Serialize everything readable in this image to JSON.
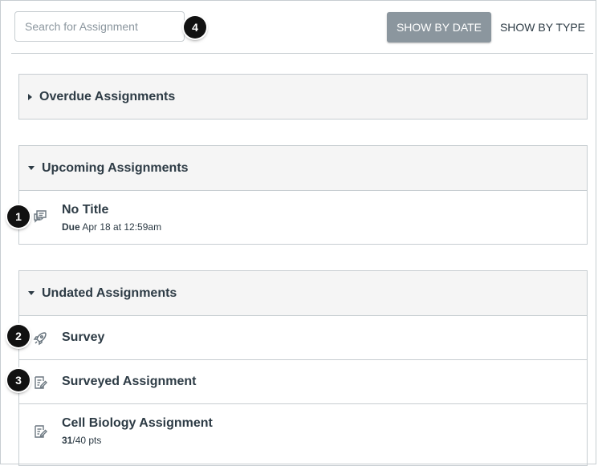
{
  "search": {
    "placeholder": "Search for Assignment"
  },
  "toolbar": {
    "show_by_date": "SHOW BY DATE",
    "show_by_type": "SHOW BY TYPE"
  },
  "groups": [
    {
      "label": "Overdue Assignments",
      "expanded": false,
      "items": []
    },
    {
      "label": "Upcoming Assignments",
      "expanded": true,
      "items": [
        {
          "title": "No Title",
          "due_label": "Due",
          "due_value": "Apr 18 at 12:59am",
          "icon": "discussion-icon"
        }
      ]
    },
    {
      "label": "Undated Assignments",
      "expanded": true,
      "items": [
        {
          "title": "Survey",
          "icon": "survey-rocket-icon"
        },
        {
          "title": "Surveyed Assignment",
          "icon": "assignment-icon"
        },
        {
          "title": "Cell Biology Assignment",
          "score": "31",
          "points": "/40 pts",
          "icon": "assignment-icon"
        }
      ]
    }
  ],
  "callouts": [
    "1",
    "2",
    "3",
    "4"
  ],
  "colors": {
    "header_bg": "#f5f5f5",
    "border": "#c7cdd1",
    "text": "#2d3b45",
    "active_button": "#8b969e"
  }
}
